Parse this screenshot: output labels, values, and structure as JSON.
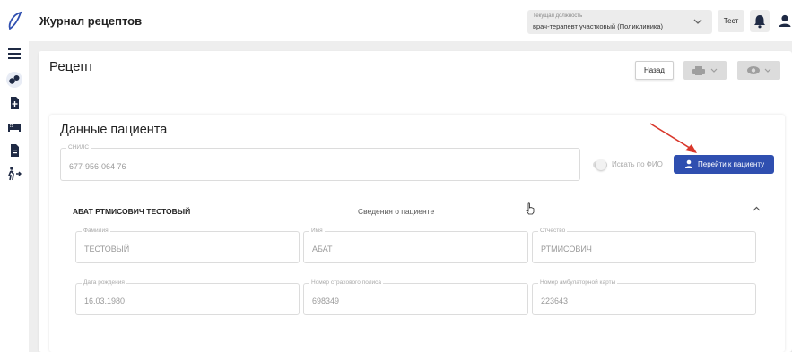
{
  "header": {
    "app_title": "Журнал рецептов",
    "position_label": "Текущая должность",
    "position_value": "врач-терапевт участковый (Поликлиника)",
    "user_button_label": "Тест"
  },
  "sidebar": {
    "items": [
      {
        "icon": "menu-icon"
      },
      {
        "icon": "pills-icon"
      },
      {
        "icon": "add-document-icon"
      },
      {
        "icon": "bed-icon"
      },
      {
        "icon": "document-icon"
      },
      {
        "icon": "walking-person-icon"
      }
    ]
  },
  "page": {
    "title": "Рецепт",
    "back_label": "Назад"
  },
  "patient": {
    "title": "Данные пациента",
    "snils_label": "СНИЛС",
    "snils_value": "677-956-064 76",
    "search_by_name_label": "Искать по ФИО",
    "search_by_name_on": false,
    "go_to_patient_label": "Перейти к пациенту",
    "name_header": "АБАТ РТМИСОВИЧ ТЕСТОВЫЙ",
    "info_tab_label": "Сведения о пациенте",
    "fields": {
      "last_name": {
        "label": "Фамилия",
        "value": "ТЕСТОВЫЙ"
      },
      "first_name": {
        "label": "Имя",
        "value": "АБАТ"
      },
      "patronymic": {
        "label": "Отчество",
        "value": "РТМИСОВИЧ"
      },
      "birth_date": {
        "label": "Дата рождения",
        "value": "16.03.1980"
      },
      "policy_number": {
        "label": "Номер страхового полиса",
        "value": "698349"
      },
      "outpatient_card": {
        "label": "Номер амбулаторной карты",
        "value": "223643"
      }
    }
  },
  "colors": {
    "primary": "#2f4fb0",
    "annotation_arrow": "#d9372b",
    "background": "#eeeeee"
  }
}
